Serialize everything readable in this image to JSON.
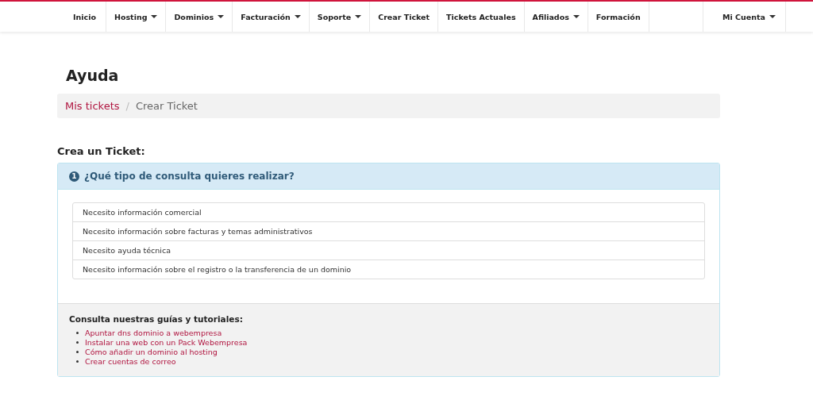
{
  "nav": {
    "items": [
      {
        "label": "Inicio",
        "dropdown": false
      },
      {
        "label": "Hosting",
        "dropdown": true
      },
      {
        "label": "Dominios",
        "dropdown": true
      },
      {
        "label": "Facturación",
        "dropdown": true
      },
      {
        "label": "Soporte",
        "dropdown": true
      },
      {
        "label": "Crear Ticket",
        "dropdown": false
      },
      {
        "label": "Tickets Actuales",
        "dropdown": false
      },
      {
        "label": "Afiliados",
        "dropdown": true
      },
      {
        "label": "Formación",
        "dropdown": false
      }
    ],
    "account": {
      "label": "Mi Cuenta",
      "dropdown": true
    }
  },
  "page_title": "Ayuda",
  "breadcrumb": {
    "link": "Mis tickets",
    "separator": "/",
    "current": "Crear Ticket"
  },
  "section_title": "Crea un Ticket:",
  "step": {
    "number": "1",
    "question": "¿Qué tipo de consulta quieres realizar?",
    "options": [
      "Necesito información comercial",
      "Necesito información sobre facturas y temas administrativos",
      "Necesito ayuda técnica",
      "Necesito información sobre el registro o la transferencia de un dominio"
    ]
  },
  "guides": {
    "title": "Consulta nuestras guías y tutoriales:",
    "links": [
      "Apuntar dns dominio a webempresa",
      "Instalar una web con un Pack Webempresa",
      "Cómo añadir un dominio al hosting",
      "Crear cuentas de correo"
    ]
  }
}
